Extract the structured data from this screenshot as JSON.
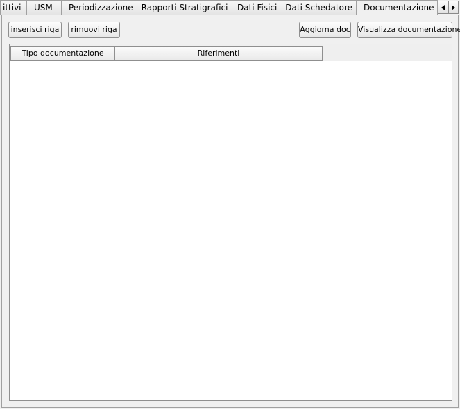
{
  "tabs": [
    {
      "label": "ittivi"
    },
    {
      "label": "USM"
    },
    {
      "label": "Periodizzazione - Rapporti Stratigrafici"
    },
    {
      "label": "Dati Fisici - Dati Schedatore"
    },
    {
      "label": "Documentazione",
      "active": true
    }
  ],
  "toolbar": {
    "insert_row": "inserisci riga",
    "remove_row": "rimuovi riga",
    "update_doc": "Aggiorna doc",
    "view_doc": "Visualizza documentazione"
  },
  "table": {
    "columns": [
      "Tipo documentazione",
      "Riferimenti"
    ],
    "rows": []
  },
  "icons": {
    "scroll_left": "left-arrow-icon",
    "scroll_right": "right-arrow-icon"
  }
}
